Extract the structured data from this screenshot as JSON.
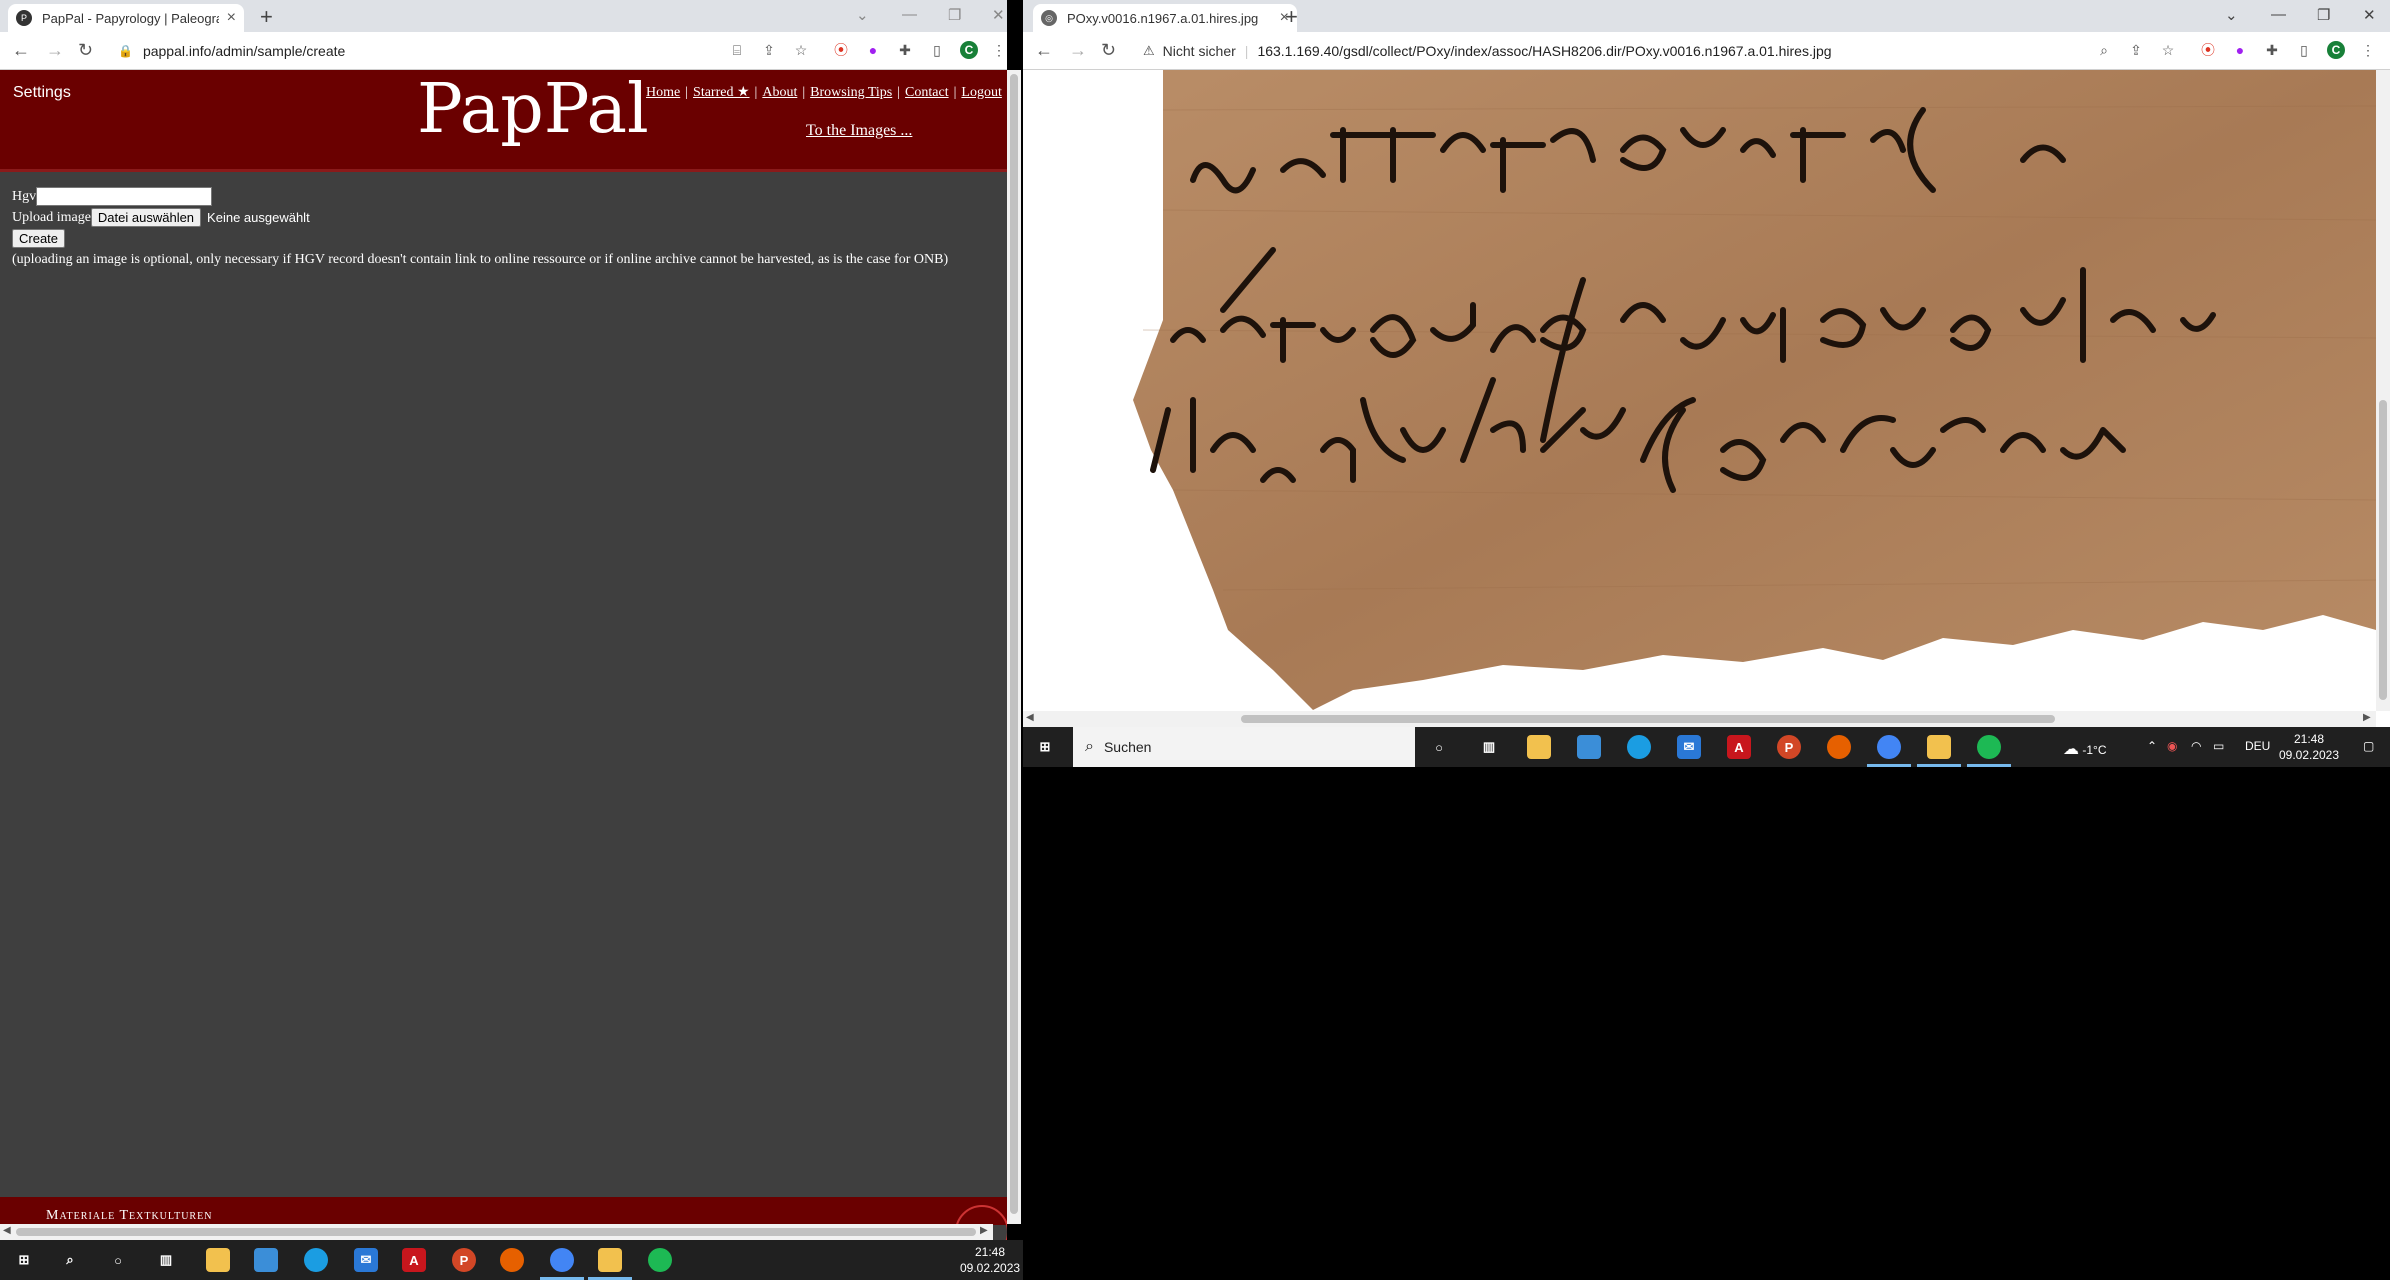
{
  "left_browser": {
    "tab_title": "PapPal - Papyrology | Paleography",
    "url": "pappal.info/admin/sample/create"
  },
  "right_browser": {
    "tab_title": "POxy.v0016.n1967.a.01.hires.jpg",
    "security_label": "Nicht sicher",
    "url": "163.1.169.40/gsdl/collect/POxy/index/assoc/HASH8206.dir/POxy.v0016.n1967.a.01.hires.jpg"
  },
  "pappal": {
    "settings": "Settings",
    "logo": "PapPal",
    "nav": {
      "home": "Home",
      "starred": "Starred ★",
      "about": "About",
      "tips": "Browsing Tips",
      "contact": "Contact",
      "logout": "Logout",
      "sep": "|"
    },
    "to_images": "To the Images ...",
    "form": {
      "hgv_label": "Hgv",
      "hgv_value": "",
      "upload_label": "Upload image",
      "file_button": "Datei auswählen",
      "file_status": "Keine ausgewählt",
      "create_button": "Create",
      "note": "(uploading an image is optional, only necessary if HGV record doesn't contain link to online ressource or if online archive cannot be harvested, as is the case for ONB)"
    },
    "footer": "Materiale Textkulturen"
  },
  "taskbar_left": {
    "time": "21:48",
    "date": "09.02.2023"
  },
  "taskbar_right": {
    "search_placeholder": "Suchen",
    "weather": "-1°C",
    "lang": "DEU",
    "time": "21:48",
    "date": "09.02.2023"
  },
  "colors": {
    "pappal_red": "#6a0000",
    "page_bg": "#3f3f3f",
    "taskbar": "#202020",
    "papyrus": "#b08560"
  }
}
